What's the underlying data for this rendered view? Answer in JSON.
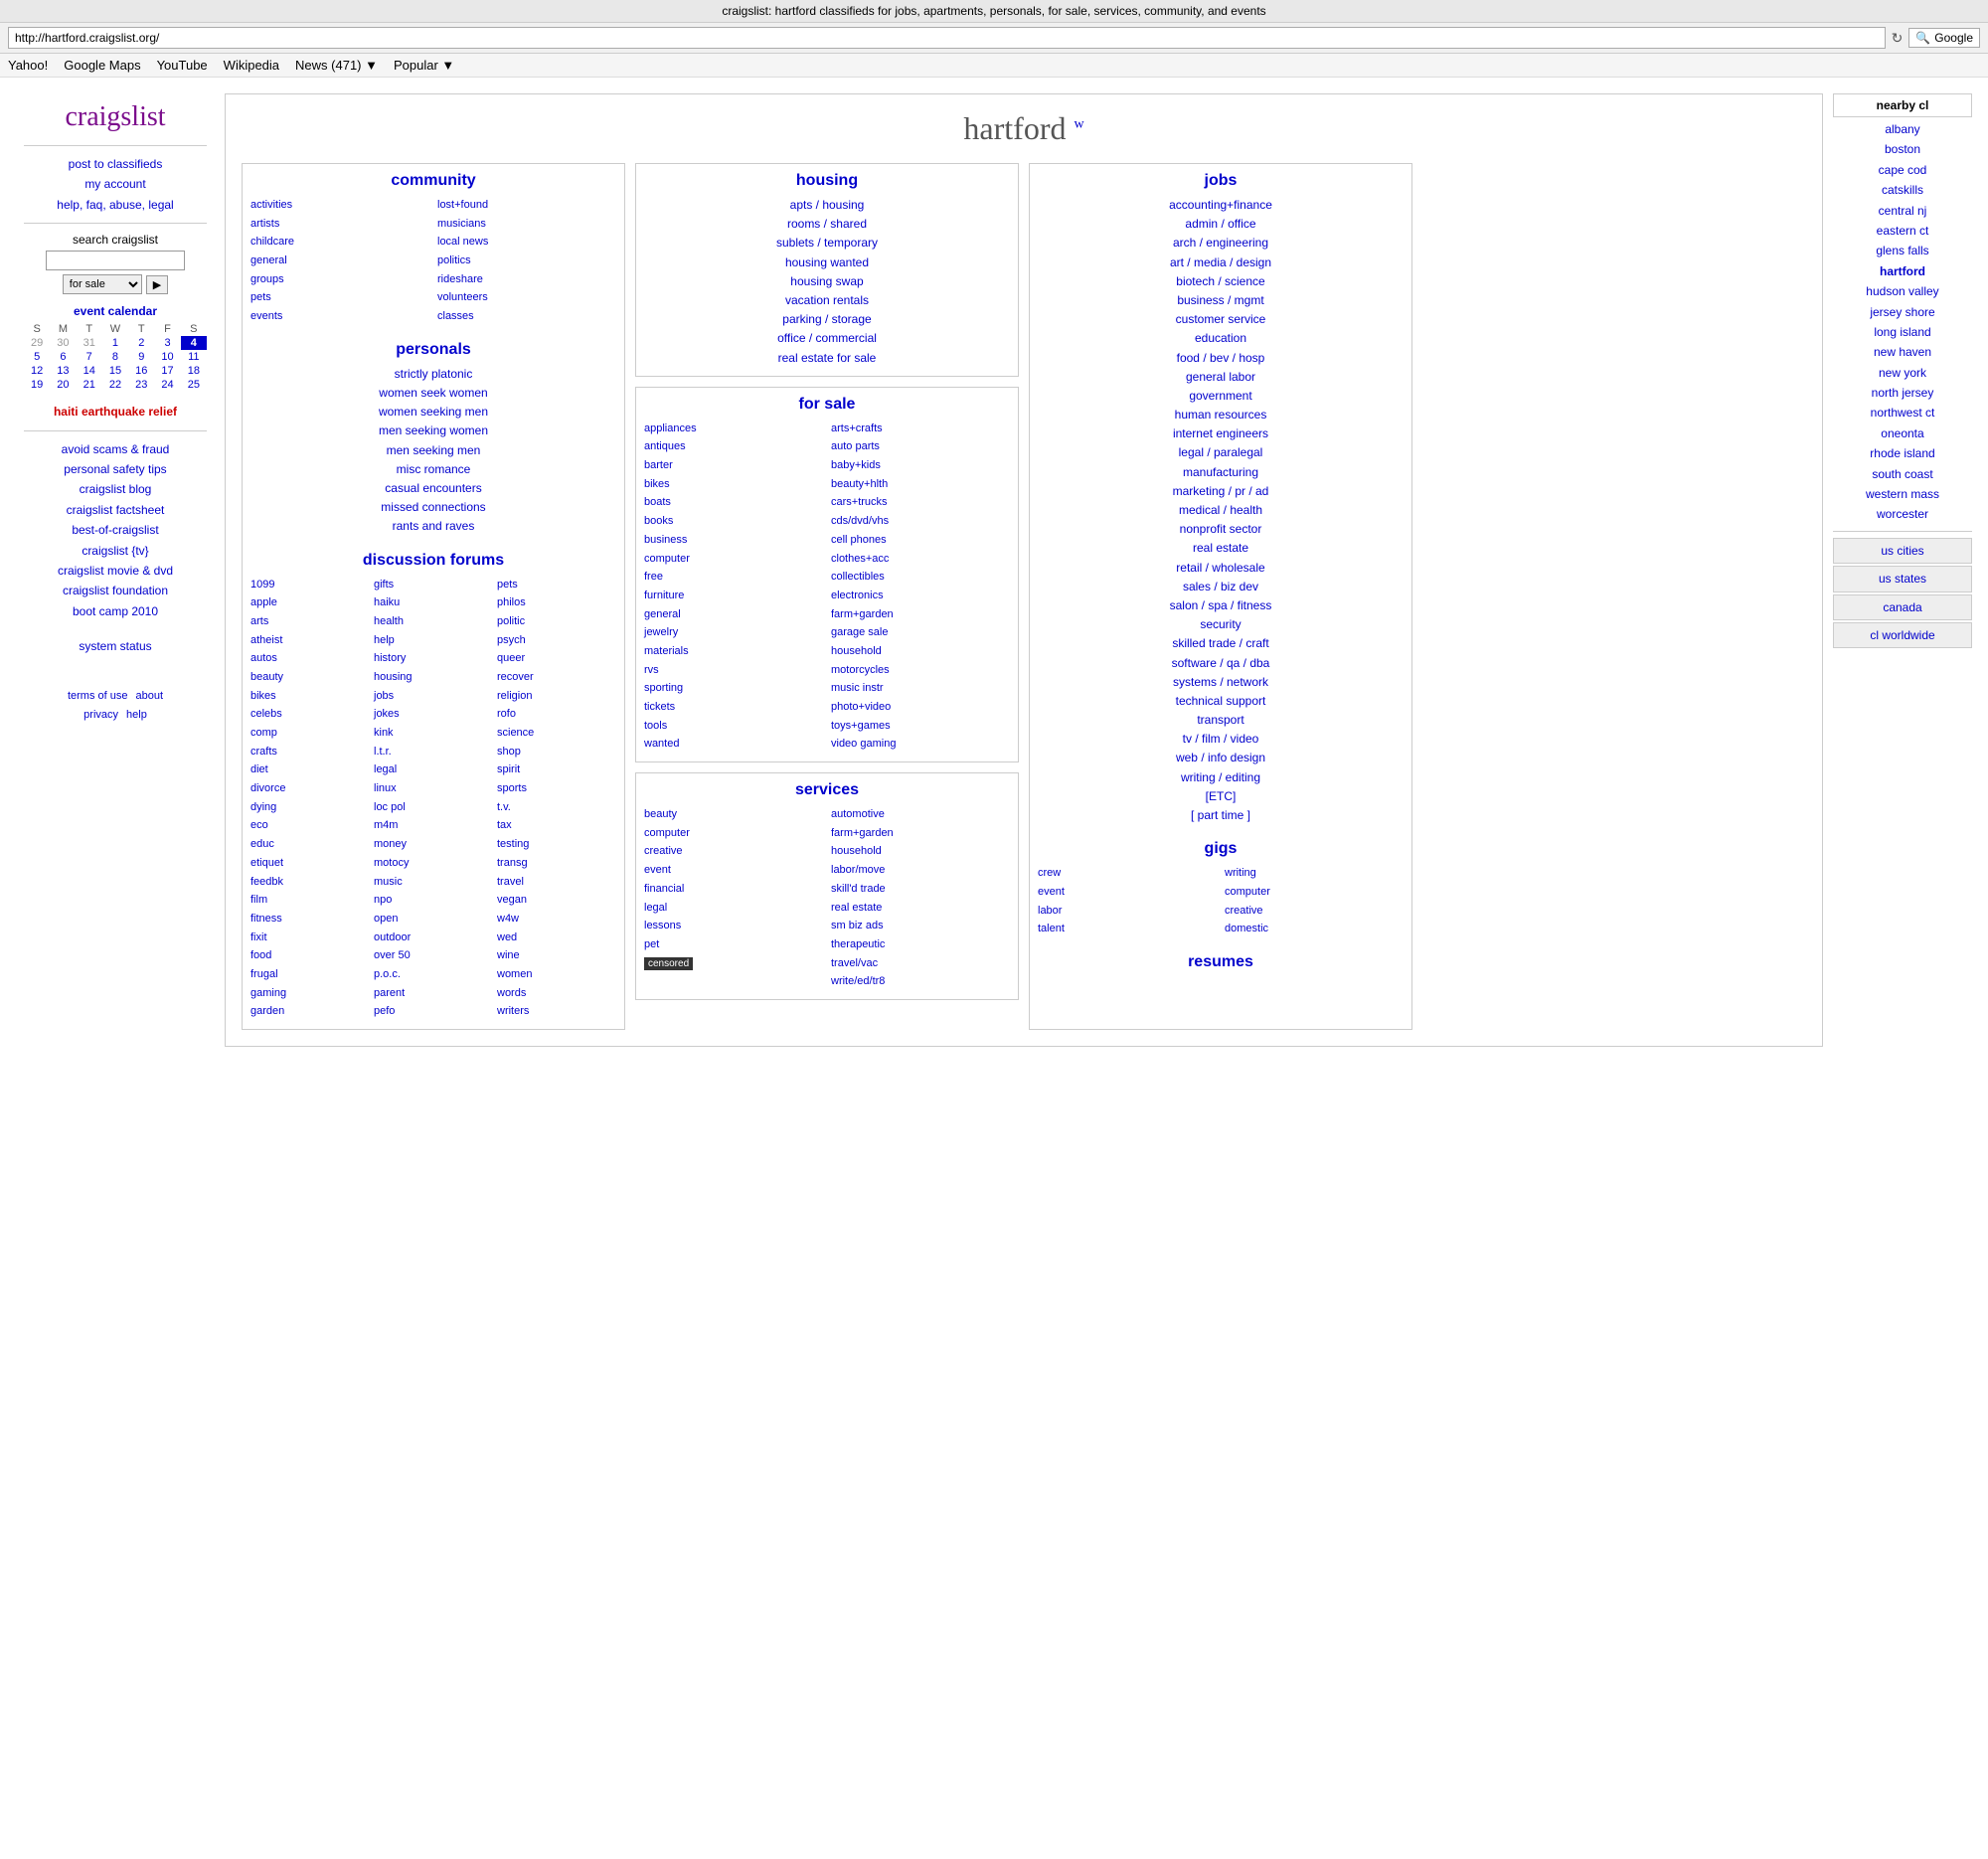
{
  "browser": {
    "title": "craigslist: hartford classifieds for jobs, apartments, personals, for sale, services, community, and events",
    "address": "http://hartford.craigslist.org/",
    "search_placeholder": "Google",
    "nav_items": [
      "Yahoo!",
      "Google Maps",
      "YouTube",
      "Wikipedia",
      "News (471) ▼",
      "Popular ▼"
    ]
  },
  "sidebar": {
    "logo": "craigslist",
    "links": [
      "post to classifieds",
      "my account",
      "help, faq, abuse, legal"
    ],
    "search_label": "search craigslist",
    "search_placeholder": "",
    "search_option": "for sale",
    "search_go": "▶",
    "calendar_title": "event calendar",
    "calendar_days": [
      "S",
      "M",
      "T",
      "W",
      "T",
      "F",
      "S"
    ],
    "calendar_weeks": [
      [
        "29",
        "30",
        "31",
        "1",
        "2",
        "3",
        "4"
      ],
      [
        "5",
        "6",
        "7",
        "8",
        "9",
        "10",
        "11"
      ],
      [
        "12",
        "13",
        "14",
        "15",
        "16",
        "17",
        "18"
      ],
      [
        "19",
        "20",
        "21",
        "22",
        "23",
        "24",
        "25"
      ]
    ],
    "today": "4",
    "haiti_link": "haiti earthquake relief",
    "extra_links": [
      "avoid scams & fraud",
      "personal safety tips",
      "craigslist blog",
      "craigslist factsheet",
      "best-of-craigslist",
      "craigslist {tv}",
      "craigslist movie & dvd",
      "craigslist foundation",
      "boot camp 2010",
      "system status"
    ],
    "footer_links1": [
      "terms of use",
      "about"
    ],
    "footer_links2": [
      "privacy",
      "help"
    ]
  },
  "main": {
    "city": "hartford",
    "city_suffix": "w",
    "community": {
      "title": "community",
      "col1": [
        "activities",
        "artists",
        "childcare",
        "general",
        "groups",
        "pets",
        "events"
      ],
      "col2": [
        "lost+found",
        "musicians",
        "local news",
        "politics",
        "rideshare",
        "volunteers",
        "classes"
      ]
    },
    "personals": {
      "title": "personals",
      "links": [
        "strictly platonic",
        "women seek women",
        "women seeking men",
        "men seeking women",
        "men seeking men",
        "misc romance",
        "casual encounters",
        "missed connections",
        "rants and raves"
      ]
    },
    "discussion": {
      "title": "discussion forums",
      "col1": [
        "1099",
        "apple",
        "arts",
        "atheist",
        "autos",
        "beauty",
        "bikes",
        "celebs",
        "comp",
        "crafts",
        "diet",
        "divorce",
        "dying",
        "eco",
        "educ",
        "etiquet",
        "feedbk",
        "film",
        "fitness",
        "fixit",
        "food",
        "frugal",
        "gaming",
        "garden"
      ],
      "col2": [
        "gifts",
        "haiku",
        "health",
        "help",
        "history",
        "housing",
        "jobs",
        "jokes",
        "kink",
        "l.t.r.",
        "legal",
        "linux",
        "loc pol",
        "m4m",
        "money",
        "motocy",
        "music",
        "npo",
        "open",
        "outdoor",
        "over 50",
        "p.o.c.",
        "parent",
        "pefo"
      ],
      "col3": [
        "pets",
        "philos",
        "politic",
        "psych",
        "queer",
        "recover",
        "religion",
        "rofo",
        "science",
        "shop",
        "spirit",
        "sports",
        "t.v.",
        "tax",
        "testing",
        "transg",
        "travel",
        "vegan",
        "w4w",
        "wed",
        "wine",
        "women",
        "words",
        "writers"
      ]
    },
    "housing": {
      "title": "housing",
      "links": [
        "apts / housing",
        "rooms / shared",
        "sublets / temporary",
        "housing wanted",
        "housing swap",
        "vacation rentals",
        "parking / storage",
        "office / commercial",
        "real estate for sale"
      ]
    },
    "for_sale": {
      "title": "for sale",
      "col1": [
        "appliances",
        "antiques",
        "barter",
        "bikes",
        "boats",
        "books",
        "business",
        "computer",
        "free",
        "furniture",
        "general",
        "jewelry",
        "materials",
        "rvs",
        "sporting",
        "tickets",
        "tools",
        "wanted"
      ],
      "col2": [
        "arts+crafts",
        "auto parts",
        "baby+kids",
        "beauty+hlth",
        "cars+trucks",
        "cds/dvd/vhs",
        "cell phones",
        "clothes+acc",
        "collectibles",
        "electronics",
        "farm+garden",
        "garage sale",
        "household",
        "motorcycles",
        "music instr",
        "photo+video",
        "toys+games",
        "video gaming"
      ]
    },
    "services": {
      "title": "services",
      "col1": [
        "beauty",
        "computer",
        "creative",
        "event",
        "financial",
        "legal",
        "lessons",
        "pet",
        "censored"
      ],
      "col2": [
        "automotive",
        "farm+garden",
        "household",
        "labor/move",
        "skill'd trade",
        "real estate",
        "sm biz ads",
        "therapeutic",
        "travel/vac",
        "write/ed/tr8"
      ]
    },
    "jobs": {
      "title": "jobs",
      "links": [
        "accounting+finance",
        "admin / office",
        "arch / engineering",
        "art / media / design",
        "biotech / science",
        "business / mgmt",
        "customer service",
        "education",
        "food / bev / hosp",
        "general labor",
        "government",
        "human resources",
        "internet engineers",
        "legal / paralegal",
        "manufacturing",
        "marketing / pr / ad",
        "medical / health",
        "nonprofit sector",
        "real estate",
        "retail / wholesale",
        "sales / biz dev",
        "salon / spa / fitness",
        "security",
        "skilled trade / craft",
        "software / qa / dba",
        "systems / network",
        "technical support",
        "transport",
        "tv / film / video",
        "web / info design",
        "writing / editing",
        "[ETC]",
        "[ part time ]"
      ]
    },
    "gigs": {
      "title": "gigs",
      "col1": [
        "crew",
        "event",
        "labor",
        "talent"
      ],
      "col2": [
        "writing",
        "computer",
        "creative",
        "domestic"
      ]
    },
    "resumes": {
      "title": "resumes"
    }
  },
  "right_sidebar": {
    "title": "nearby cl",
    "cities": [
      "albany",
      "boston",
      "cape cod",
      "catskills",
      "central nj",
      "eastern ct",
      "glens falls",
      "hartford",
      "hudson valley",
      "jersey shore",
      "long island",
      "new haven",
      "new york",
      "north jersey",
      "northwest ct",
      "oneonta",
      "rhode island",
      "south coast",
      "western mass",
      "worcester"
    ],
    "hartford_bold": "hartford",
    "sections": [
      "us cities",
      "us states",
      "canada",
      "cl worldwide"
    ]
  }
}
